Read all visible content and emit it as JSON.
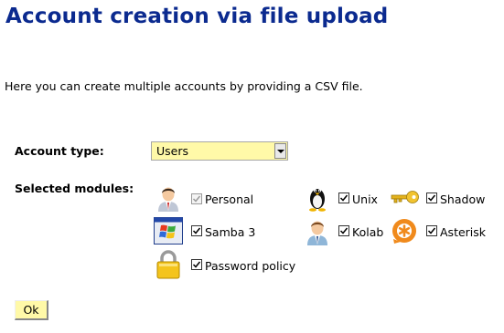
{
  "title": "Account creation via file upload",
  "intro": "Here you can create multiple accounts by providing a CSV file.",
  "account_type": {
    "label": "Account type:",
    "value": "Users"
  },
  "modules": {
    "label": "Selected modules:",
    "items": [
      {
        "label": "Personal",
        "icon": "person-icon",
        "checked": true,
        "disabled": true
      },
      {
        "label": "Unix",
        "icon": "tux-penguin-icon",
        "checked": true,
        "disabled": false
      },
      {
        "label": "Shadow",
        "icon": "key-icon",
        "checked": true,
        "disabled": false
      },
      {
        "label": "Samba 3",
        "icon": "windows-icon",
        "checked": true,
        "disabled": false
      },
      {
        "label": "Kolab",
        "icon": "kolab-user-icon",
        "checked": true,
        "disabled": false
      },
      {
        "label": "Asterisk",
        "icon": "asterisk-icon",
        "checked": true,
        "disabled": false
      },
      {
        "label": "Password policy",
        "icon": "padlock-icon",
        "checked": true,
        "disabled": false
      }
    ]
  },
  "ok_button": "Ok",
  "colors": {
    "title": "#0b2a8f",
    "input_background": "#fff9a8"
  }
}
